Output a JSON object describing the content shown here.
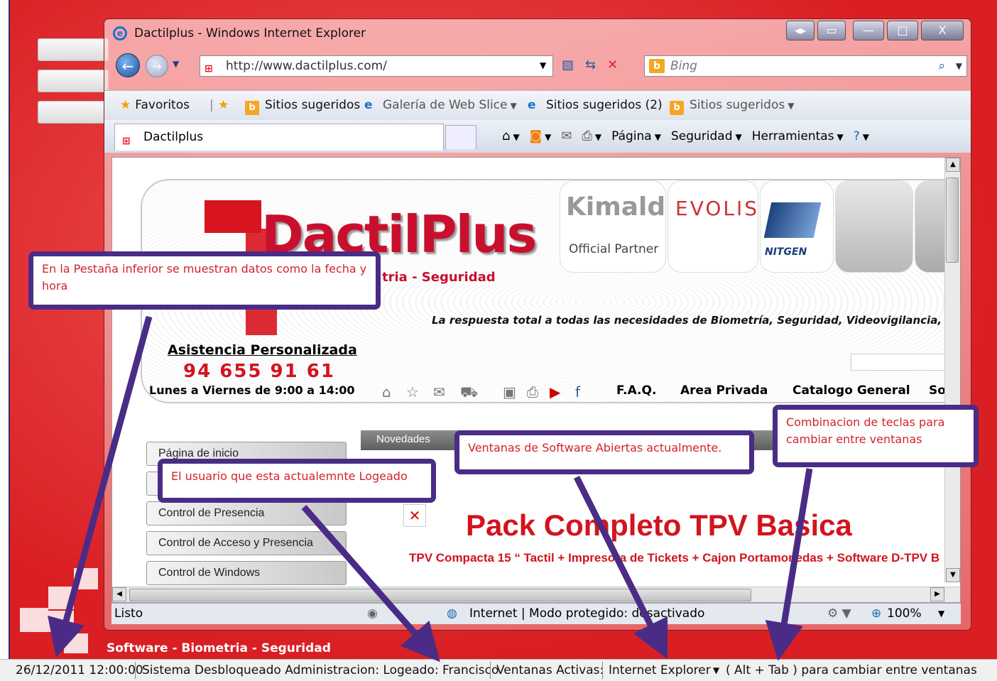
{
  "window": {
    "title": "Dactilplus - Windows Internet Explorer",
    "min_label": "—",
    "max_label": "□",
    "close_label": "X"
  },
  "address_bar": {
    "url": "http://www.dactilplus.com/",
    "search_placeholder": "Bing"
  },
  "favorites_bar": {
    "favorites_label": "Favoritos",
    "items": [
      "Sitios sugeridos",
      "Galería de Web Slice",
      "Sitios sugeridos (2)",
      "Sitios sugeridos"
    ]
  },
  "tab": {
    "title": "Dactilplus"
  },
  "command_bar": {
    "page": "Página",
    "safety": "Seguridad",
    "tools": "Herramientas"
  },
  "webpage": {
    "logo_text": "DactilPlus",
    "logo_sub": "tria - Seguridad",
    "partner_kimaldi": "Kimaldi",
    "partner_official": "Official Partner",
    "partner_evolis": "EVOLIS",
    "partner_nitgen": "NITGEN",
    "tagline": "La respuesta total a todas las necesidades de Biometría, Seguridad, Videovigilancia, TPV",
    "assist": "Asistencia Personalizada",
    "phone": "94 655 91 61",
    "hours": "Lunes a Viernes de 9:00 a 14:00",
    "nav": [
      "F.A.Q.",
      "Area Privada",
      "Catalogo General",
      "Sop"
    ],
    "menu": [
      "Página de inicio",
      "",
      "Control de Presencia",
      "Control de Acceso y Presencia",
      "Control de Windows"
    ],
    "news_label": "Novedades",
    "pack_title": "Pack Completo TPV Basica",
    "pack_sub": "TPV Compacta 15 “ Tactil + Impresora de Tickets + Cajon Portamonedas + Software D-TPV B"
  },
  "status_bar": {
    "status": "Listo",
    "zone": "Internet | Modo protegido: desactivado",
    "zoom": "100%"
  },
  "desktop": {
    "slogan": "Software - Biometria - Seguridad"
  },
  "taskbar": {
    "datetime": "26/12/2011 12:00:00",
    "user": "Sistema Desbloqueado Administracion: Logeado: Francisco",
    "windows_label": "Ventanas Activas:",
    "active_window": "Internet Explorer",
    "hint": "( Alt + Tab ) para cambiar entre ventanas"
  },
  "annotations": {
    "date": "En la Pestaña inferior se muestran datos como la fecha y hora",
    "user": "El usuario que esta actualemnte Logeado",
    "windows": "Ventanas de Software Abiertas actualmente.",
    "keys": "Combinacion de teclas para cambiar entre ventanas"
  },
  "colors": {
    "annotation_border": "#4a2c86",
    "annotation_text": "#d2232a",
    "brand_red": "#d2141e"
  }
}
